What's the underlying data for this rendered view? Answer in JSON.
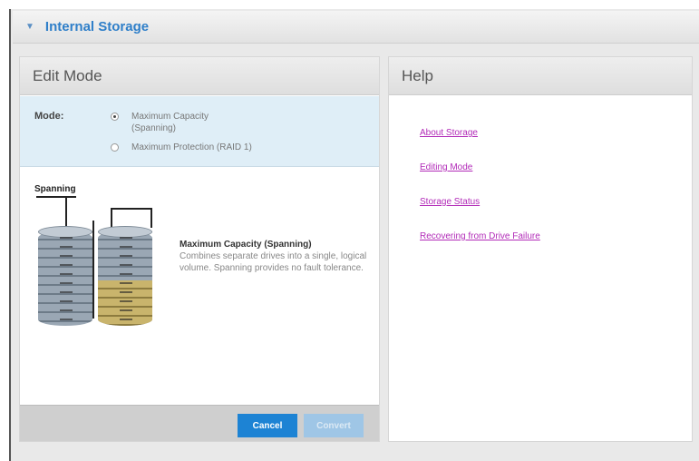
{
  "section": {
    "title": "Internal Storage",
    "chevron": "chevron-down-icon"
  },
  "edit": {
    "title": "Edit Mode",
    "mode_label": "Mode:",
    "options": [
      {
        "label": "Maximum Capacity\n(Spanning)",
        "selected": true
      },
      {
        "label": "Maximum Protection (RAID 1)",
        "selected": false
      }
    ],
    "diagram_label": "Spanning",
    "description_title": "Maximum Capacity (Spanning)",
    "description": "Combines separate drives into a single, logical volume. Spanning provides no fault tolerance.",
    "cancel_label": "Cancel",
    "confirm_label": "Convert"
  },
  "help": {
    "title": "Help",
    "links": [
      "About Storage",
      "Editing Mode",
      "Storage Status",
      "Recovering from Drive Failure"
    ]
  },
  "colors": {
    "accent": "#2f7fc9",
    "link": "#b22bb8",
    "primary_button": "#1d83d4"
  }
}
